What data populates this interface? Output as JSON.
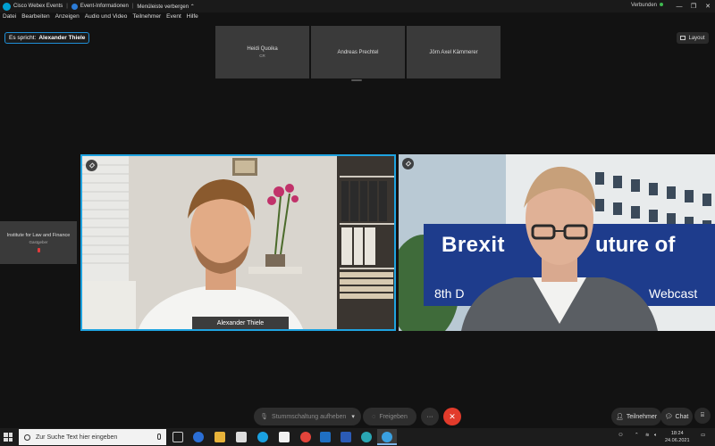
{
  "titlebar": {
    "app_name": "Cisco Webex Events",
    "event_info": "Event-Informationen",
    "hide_menu": "Menüleiste verbergen",
    "status": "Verbunden"
  },
  "menu": [
    "Datei",
    "Bearbeiten",
    "Anzeigen",
    "Audio und Video",
    "Teilnehmer",
    "Event",
    "Hilfe"
  ],
  "speaking": {
    "prefix": "Es spricht:",
    "name": "Alexander Thiele"
  },
  "layout_label": "Layout",
  "thumbnails": [
    {
      "name": "Heidi Quoika",
      "sub": "CR"
    },
    {
      "name": "Andreas Prechtel",
      "sub": ""
    },
    {
      "name": "Jörn Axel Kämmerer",
      "sub": ""
    }
  ],
  "side_tile": {
    "name": "Institute for Law and Finance",
    "sub": "Gastgeber"
  },
  "videos": {
    "left_name": "Alexander Thiele",
    "slide_title_a": "Brexit",
    "slide_title_b": "uture of",
    "slide_sub_a": "8th D",
    "slide_sub_b": "Webcast"
  },
  "controls": {
    "mute": "Stummschaltung aufheben",
    "share": "Freigeben",
    "more": "···",
    "end": "✕",
    "participants": "Teilnehmer",
    "chat": "Chat"
  },
  "taskbar": {
    "search_placeholder": "Zur Suche Text hier eingeben",
    "time": "18:24",
    "date": "24.06.2021"
  },
  "colors": {
    "active_border": "#1fa3e0",
    "end_button": "#e23b2b",
    "connected": "#3fb950",
    "slide_blue": "#1e3c8c"
  }
}
